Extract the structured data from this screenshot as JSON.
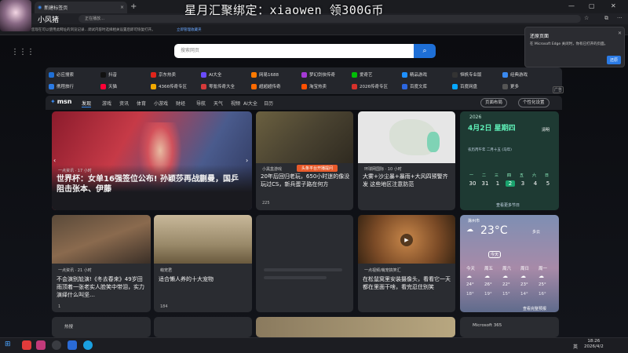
{
  "overlay": {
    "banner": "星月汇聚绑定：xiaowen  领300G币",
    "nickname": "小风猪"
  },
  "browser": {
    "tab_title": "新建标签页",
    "url_hint": "正在播放…",
    "favbar_note": "您现在可以使用此网址的浏览记录…调试内容时选择相关设置后即可恢复打开。",
    "favbar_link": "立即管理收藏夹"
  },
  "search": {
    "placeholder": "搜索网页"
  },
  "quick_links": [
    {
      "label": "必应搜索",
      "color": "#1e6fd6"
    },
    {
      "label": "抖音",
      "color": "#111"
    },
    {
      "label": "京东热卖",
      "color": "#e1251b"
    },
    {
      "label": "AI大全",
      "color": "#6a4cff"
    },
    {
      "label": "网易1688",
      "color": "#ff7a00"
    },
    {
      "label": "梦幻剑侠传奇",
      "color": "#a53ad6"
    },
    {
      "label": "爱奇艺",
      "color": "#00be06"
    },
    {
      "label": "精品游戏",
      "color": "#1e90ff"
    },
    {
      "label": "恒帆专业版",
      "color": "#333"
    },
    {
      "label": "经典游戏",
      "color": "#3a8af0"
    },
    {
      "label": "携程旅行",
      "color": "#2b7be5"
    },
    {
      "label": "天猫",
      "color": "#ff0036"
    },
    {
      "label": "4366传奇专区",
      "color": "#f2a900"
    },
    {
      "label": "零氪传奇大全",
      "color": "#d63a3a"
    },
    {
      "label": "超超超传奇",
      "color": "#ff6a00"
    },
    {
      "label": "淘宝热卖",
      "color": "#ff5000"
    },
    {
      "label": "2026传奇专区",
      "color": "#d6312b"
    },
    {
      "label": "百度文库",
      "color": "#2b66e0"
    },
    {
      "label": "百度网盘",
      "color": "#06a7ff"
    },
    {
      "label": "更多",
      "color": "#555"
    }
  ],
  "ad_label": "广告",
  "msn": {
    "logo": "msn",
    "nav": [
      "发现",
      "游戏",
      "资讯",
      "体育",
      "小游戏",
      "财经",
      "导航",
      "天气",
      "视频",
      "AI大全",
      "日历"
    ],
    "layout_btn": "页面布局",
    "personalize_btn": "个性化设置"
  },
  "cards": {
    "main": {
      "source": "一点资讯 · 17 小时",
      "title": "世界杯：女单16强签位公布! 孙颖莎再战蒯曼，国乒阻击张本、伊藤"
    },
    "news1": {
      "source": "小黑盒游戏",
      "title": "20年后回归老玩，650小时迷的像没玩过CS，新兵蛋子路在何方",
      "likes": "225",
      "popup": "头条平台开播提问"
    },
    "news2": {
      "source": "环球网国际 · 10 小时",
      "title": "大雾+沙尘暴+暴雨+大风四预警齐发 这些地区注意防范"
    },
    "news3": {
      "source": "一点资讯 · 21 小时",
      "title": "不会演别尬演!《冬去春来》49岁田雨顶着一张老实人脸笑中带泪，实力演绎什么叫坚…",
      "likes": "1"
    },
    "news4": {
      "source": "萌宠君",
      "title": "适合懒人养的十大宠物",
      "likes": "184"
    },
    "news5": {
      "source": "一点视频/萌宠搞笑汇",
      "title": "在松鼠窝里安装摄像头，看看它一天都在里面干啥，看完忍住别笑"
    },
    "hot": {
      "label": "热搜"
    },
    "m365": {
      "label": "Microsoft 365"
    }
  },
  "calendar": {
    "year": "2026",
    "date": "4月2日 星期四",
    "lunar": "二月十五",
    "lunar_note": "农历丙午年 二月十五 (马年)",
    "weekdays": [
      "一",
      "二",
      "三",
      "四",
      "五",
      "六",
      "日"
    ],
    "days": [
      "30",
      "31",
      "1",
      "2",
      "3",
      "4",
      "5"
    ],
    "more": "查看更多节日",
    "today_label": "清明"
  },
  "weather": {
    "city": "滁州市",
    "temp": "23°C",
    "desc": "多云",
    "today": "今天",
    "forecast": [
      {
        "day": "今天",
        "hi": "24°",
        "lo": "18°"
      },
      {
        "day": "周五",
        "hi": "26°",
        "lo": "19°"
      },
      {
        "day": "周六",
        "hi": "22°",
        "lo": "15°"
      },
      {
        "day": "周日",
        "hi": "23°",
        "lo": "14°"
      },
      {
        "day": "周一",
        "hi": "25°",
        "lo": "16°"
      }
    ],
    "more": "查看完整预报"
  },
  "notification": {
    "title": "还原页面",
    "body": "在 Microsoft Edge 关闭时，你有已打开的页面。",
    "button": "还原"
  },
  "taskbar": {
    "time": "18:26",
    "date": "2026/4/2",
    "lang": "英"
  }
}
